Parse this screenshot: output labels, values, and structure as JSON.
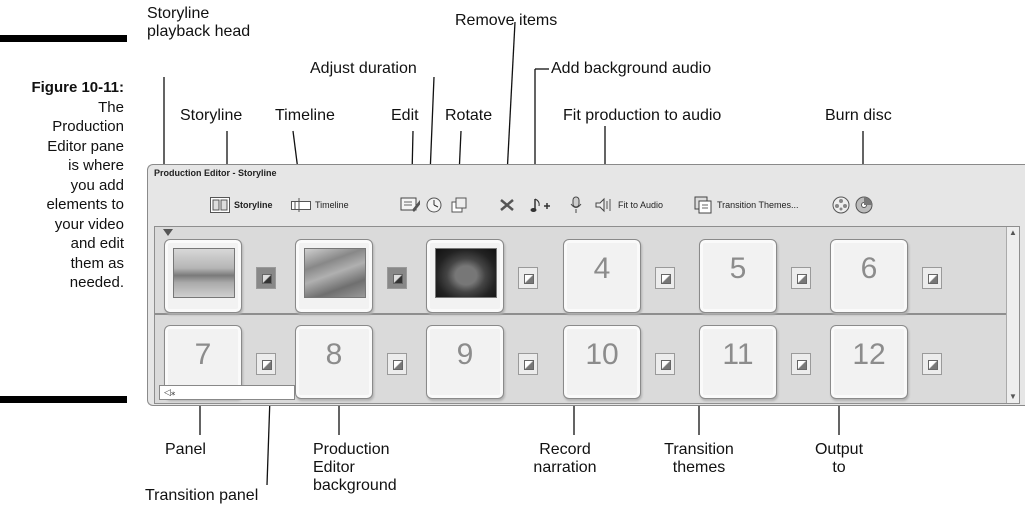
{
  "figure": {
    "number": "Figure 10-11:",
    "caption_lines": [
      "The",
      "Production",
      "Editor pane",
      "is where",
      "you add",
      "elements to",
      "your video",
      "and edit",
      "them as",
      "needed."
    ]
  },
  "callouts": {
    "top": {
      "playback_head": "Storyline playback head",
      "storyline": "Storyline",
      "timeline": "Timeline",
      "adjust_duration": "Adjust duration",
      "edit": "Edit",
      "rotate": "Rotate",
      "remove_items": "Remove items",
      "add_background_audio": "Add background audio",
      "fit_production_to_audio": "Fit production to audio",
      "burn_disc": "Burn disc"
    },
    "bottom": {
      "panel": "Panel",
      "transition_panel": "Transition panel",
      "production_editor_background": "Production Editor background",
      "record_narration": "Record narration",
      "transition_themes": "Transition themes",
      "output_to": "Output to"
    }
  },
  "window": {
    "title": "Production Editor - Storyline",
    "toolbar": {
      "storyline_label": "Storyline",
      "timeline_label": "Timeline",
      "fit_to_audio_label": "Fit to Audio",
      "transition_themes_label": "Transition Themes..."
    },
    "icons": [
      "storyline-view-icon",
      "timeline-view-icon",
      "edit-icon",
      "adjust-duration-icon",
      "rotate-icon",
      "remove-icon",
      "add-audio-icon",
      "microphone-icon",
      "fit-to-audio-icon",
      "transition-themes-icon",
      "output-icon",
      "burn-disc-icon"
    ],
    "panels_row1": [
      {
        "type": "image",
        "theme": "mountain-lake"
      },
      {
        "type": "image",
        "theme": "rocky-cliff"
      },
      {
        "type": "image",
        "theme": "statue"
      },
      {
        "type": "empty",
        "number": "4"
      },
      {
        "type": "empty",
        "number": "5"
      },
      {
        "type": "empty",
        "number": "6"
      }
    ],
    "panels_row2": [
      {
        "number": "7"
      },
      {
        "number": "8"
      },
      {
        "number": "9"
      },
      {
        "number": "10"
      },
      {
        "number": "11"
      },
      {
        "number": "12"
      }
    ],
    "colors": {
      "window_bg": "#e6e6e6",
      "grid_bg": "#dadada"
    }
  }
}
